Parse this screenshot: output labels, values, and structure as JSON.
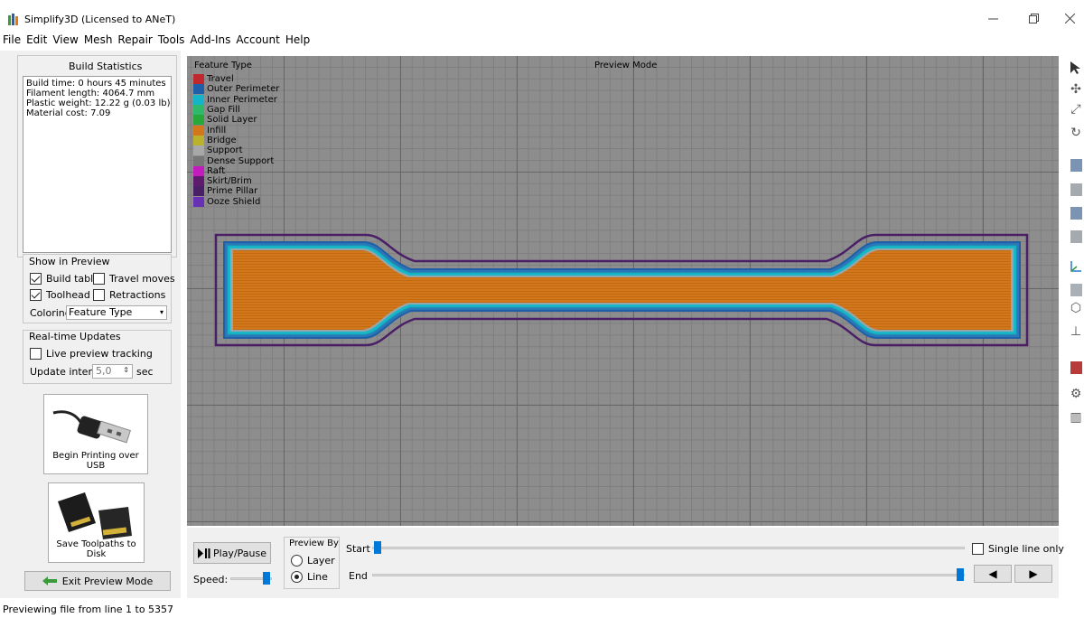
{
  "window": {
    "title": "Simplify3D (Licensed to ANeT)",
    "minimize_icon": "minimize-icon",
    "restore_icon": "restore-icon",
    "close_icon": "close-icon"
  },
  "menu": [
    "File",
    "Edit",
    "View",
    "Mesh",
    "Repair",
    "Tools",
    "Add-Ins",
    "Account",
    "Help"
  ],
  "build_statistics": {
    "title": "Build Statistics",
    "lines": [
      "Build time: 0 hours 45 minutes",
      "Filament length: 4064.7 mm",
      "Plastic weight: 12.22 g (0.03 lb)",
      "Material cost: 7.09"
    ]
  },
  "show_in_preview": {
    "title": "Show in Preview",
    "build_table": {
      "label": "Build table",
      "checked": true
    },
    "travel_moves": {
      "label": "Travel moves",
      "checked": false
    },
    "toolhead": {
      "label": "Toolhead",
      "checked": true
    },
    "retractions": {
      "label": "Retractions",
      "checked": false
    },
    "coloring_label": "Coloring",
    "coloring_value": "Feature Type"
  },
  "realtime": {
    "title": "Real-time Updates",
    "live_label": "Live preview tracking",
    "live_checked": false,
    "interval_label": "Update interval",
    "interval_value": "5,0",
    "interval_unit": "sec"
  },
  "actions": {
    "usb_label": "Begin Printing over USB",
    "disk_label": "Save Toolpaths to Disk",
    "exit_label": "Exit Preview Mode"
  },
  "legend": {
    "title": "Feature Type",
    "items": [
      {
        "label": "Travel",
        "color": "#c0282d"
      },
      {
        "label": "Outer Perimeter",
        "color": "#1f5fa8"
      },
      {
        "label": "Inner Perimeter",
        "color": "#15b5c9"
      },
      {
        "label": "Gap Fill",
        "color": "#2fba6b"
      },
      {
        "label": "Solid Layer",
        "color": "#27a83a"
      },
      {
        "label": "Infill",
        "color": "#d2781a"
      },
      {
        "label": "Bridge",
        "color": "#bcb12c"
      },
      {
        "label": "Support",
        "color": "#a8a8a8"
      },
      {
        "label": "Dense Support",
        "color": "#777777"
      },
      {
        "label": "Raft",
        "color": "#c21cbf"
      },
      {
        "label": "Skirt/Brim",
        "color": "#5e1a6b"
      },
      {
        "label": "Prime Pillar",
        "color": "#4a1f66"
      },
      {
        "label": "Ooze Shield",
        "color": "#6930b3"
      }
    ]
  },
  "preview_mode_label": "Preview Mode",
  "controls": {
    "play_label": "Play/Pause",
    "speed_label": "Speed:",
    "preview_by_label": "Preview By",
    "layer_label": "Layer",
    "line_label": "Line",
    "selected_mode": "Line",
    "start_label": "Start",
    "end_label": "End",
    "single_line_label": "Single line only",
    "single_line_checked": false
  },
  "status": "Previewing file from line 1 to 5357"
}
